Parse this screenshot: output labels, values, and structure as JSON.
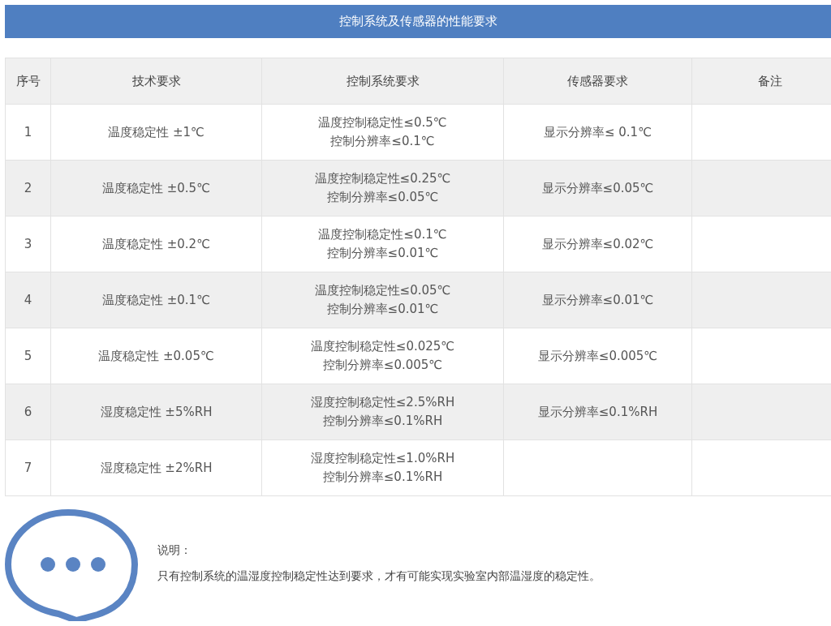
{
  "title": "控制系统及传感器的性能要求",
  "table": {
    "columns": [
      "序号",
      "技术要求",
      "控制系统要求",
      "传感器要求",
      "备注"
    ],
    "rows": [
      {
        "index": "1",
        "requirement": "温度稳定性 ±1℃",
        "control": [
          "温度控制稳定性≤0.5℃",
          "控制分辨率≤0.1℃"
        ],
        "sensor": "显示分辨率≤ 0.1℃"
      },
      {
        "index": "2",
        "requirement": "温度稳定性 ±0.5℃",
        "control": [
          "温度控制稳定性≤0.25℃",
          "控制分辨率≤0.05℃"
        ],
        "sensor": "显示分辨率≤0.05℃"
      },
      {
        "index": "3",
        "requirement": "温度稳定性 ±0.2℃",
        "control": [
          "温度控制稳定性≤0.1℃",
          "控制分辨率≤0.01℃"
        ],
        "sensor": "显示分辨率≤0.02℃"
      },
      {
        "index": "4",
        "requirement": "温度稳定性 ±0.1℃",
        "control": [
          "温度控制稳定性≤0.05℃",
          "控制分辨率≤0.01℃"
        ],
        "sensor": "显示分辨率≤0.01℃"
      },
      {
        "index": "5",
        "requirement": "温度稳定性 ±0.05℃",
        "control": [
          "温度控制稳定性≤0.025℃",
          "控制分辨率≤0.005℃"
        ],
        "sensor": "显示分辨率≤0.005℃"
      },
      {
        "index": "6",
        "requirement": "湿度稳定性 ±5%RH",
        "control": [
          "湿度控制稳定性≤2.5%RH",
          "控制分辨率≤0.1%RH"
        ],
        "sensor": "显示分辨率≤0.1%RH"
      },
      {
        "index": "7",
        "requirement": "湿度稳定性 ±2%RH",
        "control": [
          "湿度控制稳定性≤1.0%RH",
          "控制分辨率≤0.1%RH"
        ]
      }
    ]
  },
  "note": {
    "label": "说明：",
    "text": "只有控制系统的温湿度控制稳定性达到要求，才有可能实现实验室内部温湿度的稳定性。"
  }
}
